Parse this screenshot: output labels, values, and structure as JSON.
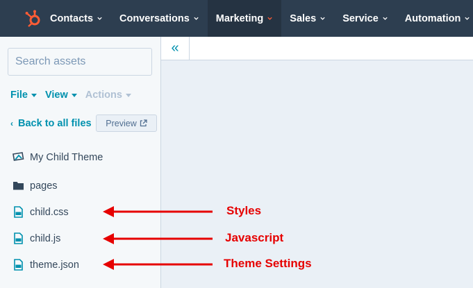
{
  "nav": {
    "items": [
      {
        "label": "Contacts",
        "active": false
      },
      {
        "label": "Conversations",
        "active": false
      },
      {
        "label": "Marketing",
        "active": true
      },
      {
        "label": "Sales",
        "active": false
      },
      {
        "label": "Service",
        "active": false
      },
      {
        "label": "Automation",
        "active": false
      }
    ]
  },
  "sidebar": {
    "search_placeholder": "Search assets",
    "menus": {
      "file": "File",
      "view": "View",
      "actions": "Actions"
    },
    "back_label": "Back to all files",
    "preview_label": "Preview",
    "tree": [
      {
        "label": "My Child Theme",
        "icon": "theme-icon"
      },
      {
        "label": "pages",
        "icon": "folder-icon"
      },
      {
        "label": "child.css",
        "icon": "css-file-icon"
      },
      {
        "label": "child.js",
        "icon": "js-file-icon"
      },
      {
        "label": "theme.json",
        "icon": "json-file-icon"
      }
    ]
  },
  "annotations": {
    "styles": "Styles",
    "javascript": "Javascript",
    "theme_settings": "Theme Settings"
  },
  "colors": {
    "nav_bg": "#2d3e50",
    "accent": "#0091ae",
    "brand_orange": "#ff5c35",
    "annotation_red": "#e60000"
  }
}
